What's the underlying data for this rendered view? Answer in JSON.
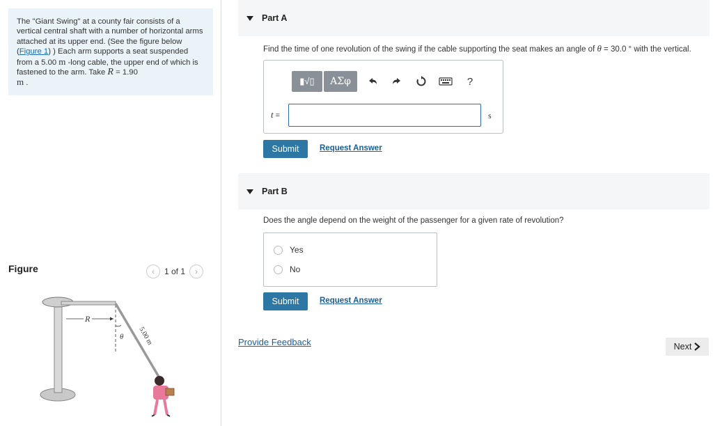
{
  "problem": {
    "text1": "The \"Giant Swing\" at a county fair consists of a vertical central shaft with a number of horizontal arms attached at its upper end. (See the figure below (",
    "figure_link": "Figure 1",
    "text2": ") ) Each arm supports a seat suspended from a 5.00 ",
    "unit_m": "m",
    "text3": " -long cable, the upper end of which is fastened to the arm. Take ",
    "var_R": "R",
    "text4": " = 1.90",
    "unit_m2": "m",
    "text5": " ."
  },
  "figure": {
    "title": "Figure",
    "pager": "1 of 1",
    "labels": {
      "R": "R",
      "theta": "θ",
      "cable": "5.00 m"
    }
  },
  "partA": {
    "title": "Part A",
    "q1": "Find the time of one revolution of the swing if the cable supporting the seat makes an angle of ",
    "theta": "θ",
    "q2": " = 30.0 ° with the vertical.",
    "toolbar": {
      "templates": "▮√▯",
      "greek": "ΑΣφ",
      "help": "?"
    },
    "var_label": "t",
    "equals": " =",
    "input_value": "",
    "unit": "s",
    "submit": "Submit",
    "request": "Request Answer"
  },
  "partB": {
    "title": "Part B",
    "question": "Does the angle depend on the weight of the passenger for a given rate of revolution?",
    "options": [
      "Yes",
      "No"
    ],
    "submit": "Submit",
    "request": "Request Answer"
  },
  "feedback": "Provide Feedback",
  "next": "Next"
}
